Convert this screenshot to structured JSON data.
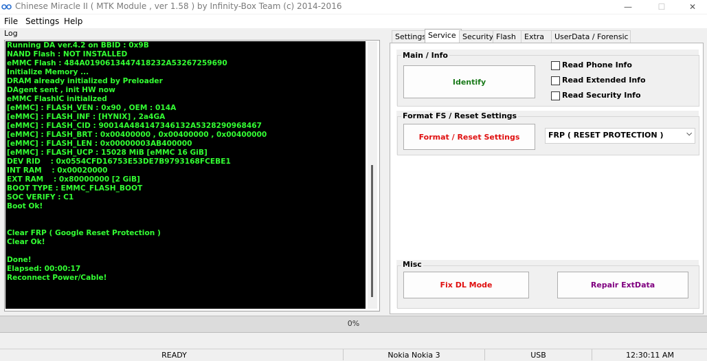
{
  "window": {
    "title": "Chinese Miracle II ( MTK Module , ver 1.58 ) by Infinity-Box Team (c) 2014-2016",
    "minimize": "—",
    "maximize": "☐",
    "close": "✕"
  },
  "menu": {
    "items": [
      "File",
      "Settings",
      "Help"
    ]
  },
  "log": {
    "label": "Log",
    "lines": [
      "Running DA ver.4.2 on BBID : 0x9B",
      "NAND Flash : NOT INSTALLED",
      "eMMC Flash : 484A0190613447418232A53267259690",
      "Initialize Memory ...",
      "DRAM already initialized by Preloader",
      "DAgent sent , init HW now",
      "eMMC FlashIC initialized",
      "[eMMC] : FLASH_VEN : 0x90 , OEM : 014A",
      "[eMMC] : FLASH_INF : [HYNIX] , 2a4GA",
      "[eMMC] : FLASH_CID : 90014A484147346132A5328290968467",
      "[eMMC] : FLASH_BRT : 0x00400000 , 0x00400000 , 0x00400000",
      "[eMMC] : FLASH_LEN : 0x00000003AB400000",
      "[eMMC] : FLASH_UCP : 15028 MiB [eMMC 16 GiB]",
      "DEV RID    : 0x0554CFD16753E53DE7B9793168FCEBE1",
      "INT RAM    : 0x00020000",
      "EXT RAM    : 0x80000000 [2 GiB]",
      "BOOT TYPE : EMMC_FLASH_BOOT",
      "SOC VERIFY : C1",
      "Boot Ok!",
      "",
      "",
      "Clear FRP ( Google Reset Protection )",
      "Clear Ok!",
      "",
      "Done!",
      "Elapsed: 00:00:17",
      "Reconnect Power/Cable!"
    ]
  },
  "tabs": [
    "Settings",
    "Service",
    "Security",
    "Flash",
    "Extra",
    "UserData / Forensic"
  ],
  "active_tab": "Service",
  "service": {
    "main_info": {
      "title": "Main / Info",
      "identify_label": "Identify",
      "checkboxes": [
        "Read Phone Info",
        "Read Extended Info",
        "Read Security Info"
      ]
    },
    "format_fs": {
      "title": "Format FS / Reset Settings",
      "format_label": "Format / Reset Settings",
      "select_value": "FRP ( RESET PROTECTION )"
    },
    "misc": {
      "title": "Misc",
      "fix_dl_label": "Fix DL Mode",
      "repair_label": "Repair ExtData"
    }
  },
  "colors": {
    "log_text": "#33ff33",
    "identify": "#1a7a1a",
    "format": "#e01010",
    "fix_dl": "#e01010",
    "repair": "#800080"
  },
  "progress": {
    "text": "0%",
    "value": 0
  },
  "status": {
    "state": "READY",
    "device": "Nokia Nokia 3",
    "port": "USB",
    "time": "12:30:11 AM"
  }
}
